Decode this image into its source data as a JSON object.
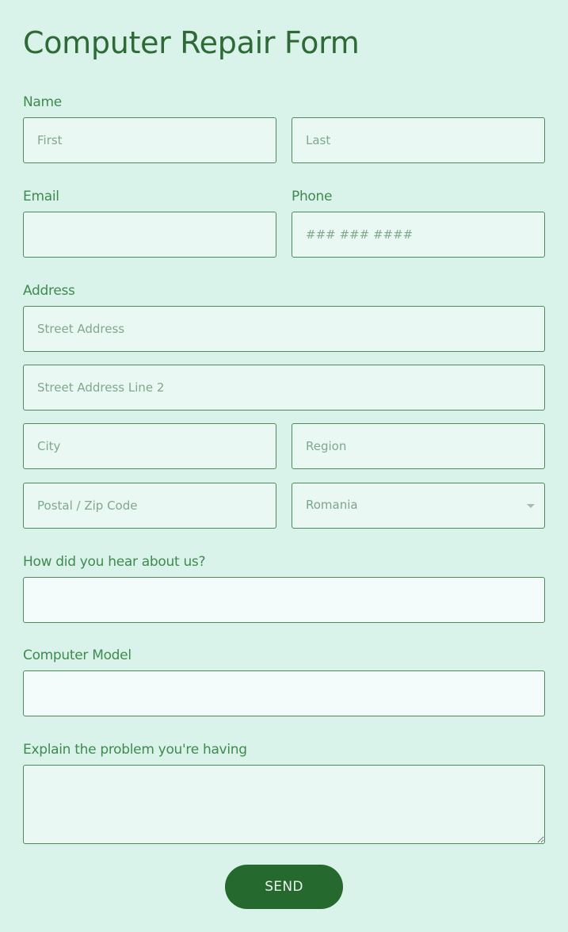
{
  "form": {
    "title": "Computer Repair Form",
    "name": {
      "label": "Name",
      "first_placeholder": "First",
      "last_placeholder": "Last"
    },
    "email": {
      "label": "Email",
      "value": ""
    },
    "phone": {
      "label": "Phone",
      "placeholder": "### ### ####"
    },
    "address": {
      "label": "Address",
      "street_placeholder": "Street Address",
      "street2_placeholder": "Street Address Line 2",
      "city_placeholder": "City",
      "region_placeholder": "Region",
      "postal_placeholder": "Postal / Zip Code",
      "country_selected": "Romania"
    },
    "referral": {
      "label": "How did you hear about us?",
      "value": ""
    },
    "model": {
      "label": "Computer Model",
      "value": ""
    },
    "problem": {
      "label": "Explain the problem you're having",
      "value": ""
    },
    "submit_label": "SEND"
  },
  "colors": {
    "background": "#d9f2ea",
    "accent": "#26692e",
    "label": "#3f8a4f",
    "border": "#4f8a5c"
  }
}
